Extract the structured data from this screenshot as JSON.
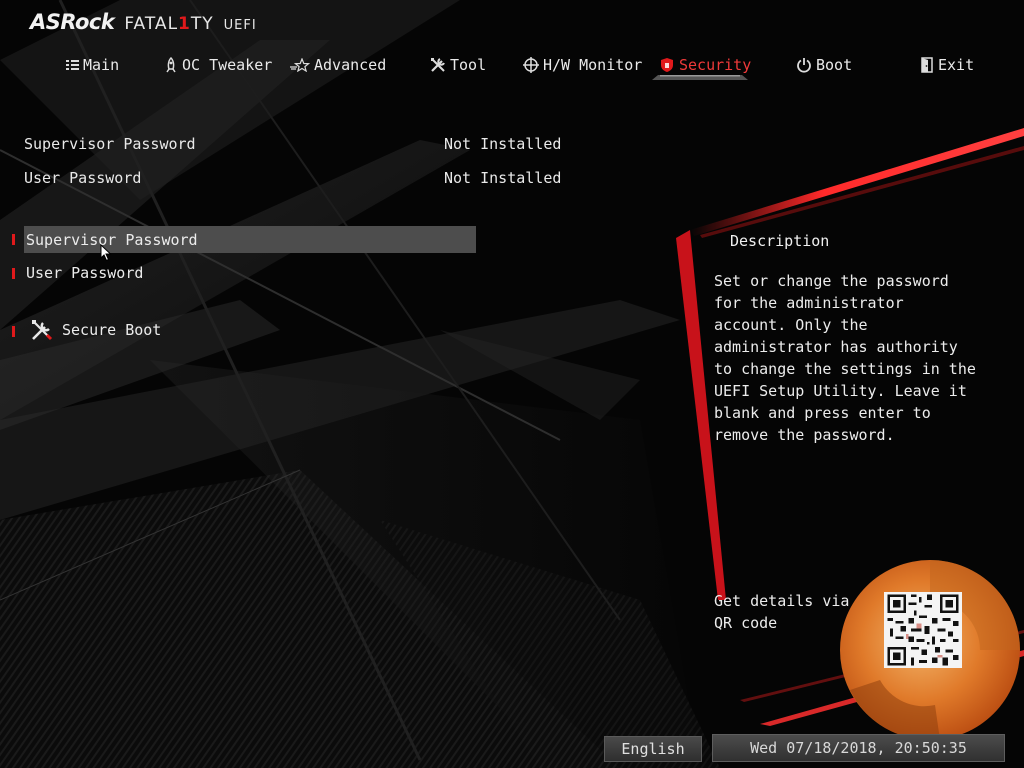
{
  "header": {
    "brand": "ASRock",
    "series_pre": "FATAL",
    "series_one": "1",
    "series_post": "TY",
    "sub": "UEFI"
  },
  "nav": {
    "tabs": [
      {
        "label": "Main",
        "icon": "list-icon"
      },
      {
        "label": "OC Tweaker",
        "icon": "rocket-icon"
      },
      {
        "label": "Advanced",
        "icon": "star-icon"
      },
      {
        "label": "Tool",
        "icon": "tools-icon"
      },
      {
        "label": "H/W Monitor",
        "icon": "crosshair-icon"
      },
      {
        "label": "Security",
        "icon": "shield-icon",
        "active": true
      },
      {
        "label": "Boot",
        "icon": "power-icon"
      },
      {
        "label": "Exit",
        "icon": "exit-door-icon"
      }
    ]
  },
  "status": {
    "rows": [
      {
        "label": "Supervisor Password",
        "value": "Not Installed"
      },
      {
        "label": "User Password",
        "value": "Not Installed"
      }
    ]
  },
  "menu": {
    "items": [
      {
        "label": "Supervisor Password",
        "selected": true
      },
      {
        "label": "User Password"
      },
      {
        "label": "Secure Boot",
        "icon": "wrench-screwdriver-icon"
      }
    ]
  },
  "description": {
    "title": "Description",
    "text": "Set or change the password for the administrator account. Only the administrator has authority to change the settings in the UEFI Setup Utility. Leave it blank and press enter to remove the password.",
    "qr_text": "Get details via QR code"
  },
  "footer": {
    "language": "English",
    "datetime": "Wed 07/18/2018, 20:50:35"
  },
  "colors": {
    "accent": "#e0191b",
    "background": "#050505",
    "selection": "#4d4d4d"
  }
}
